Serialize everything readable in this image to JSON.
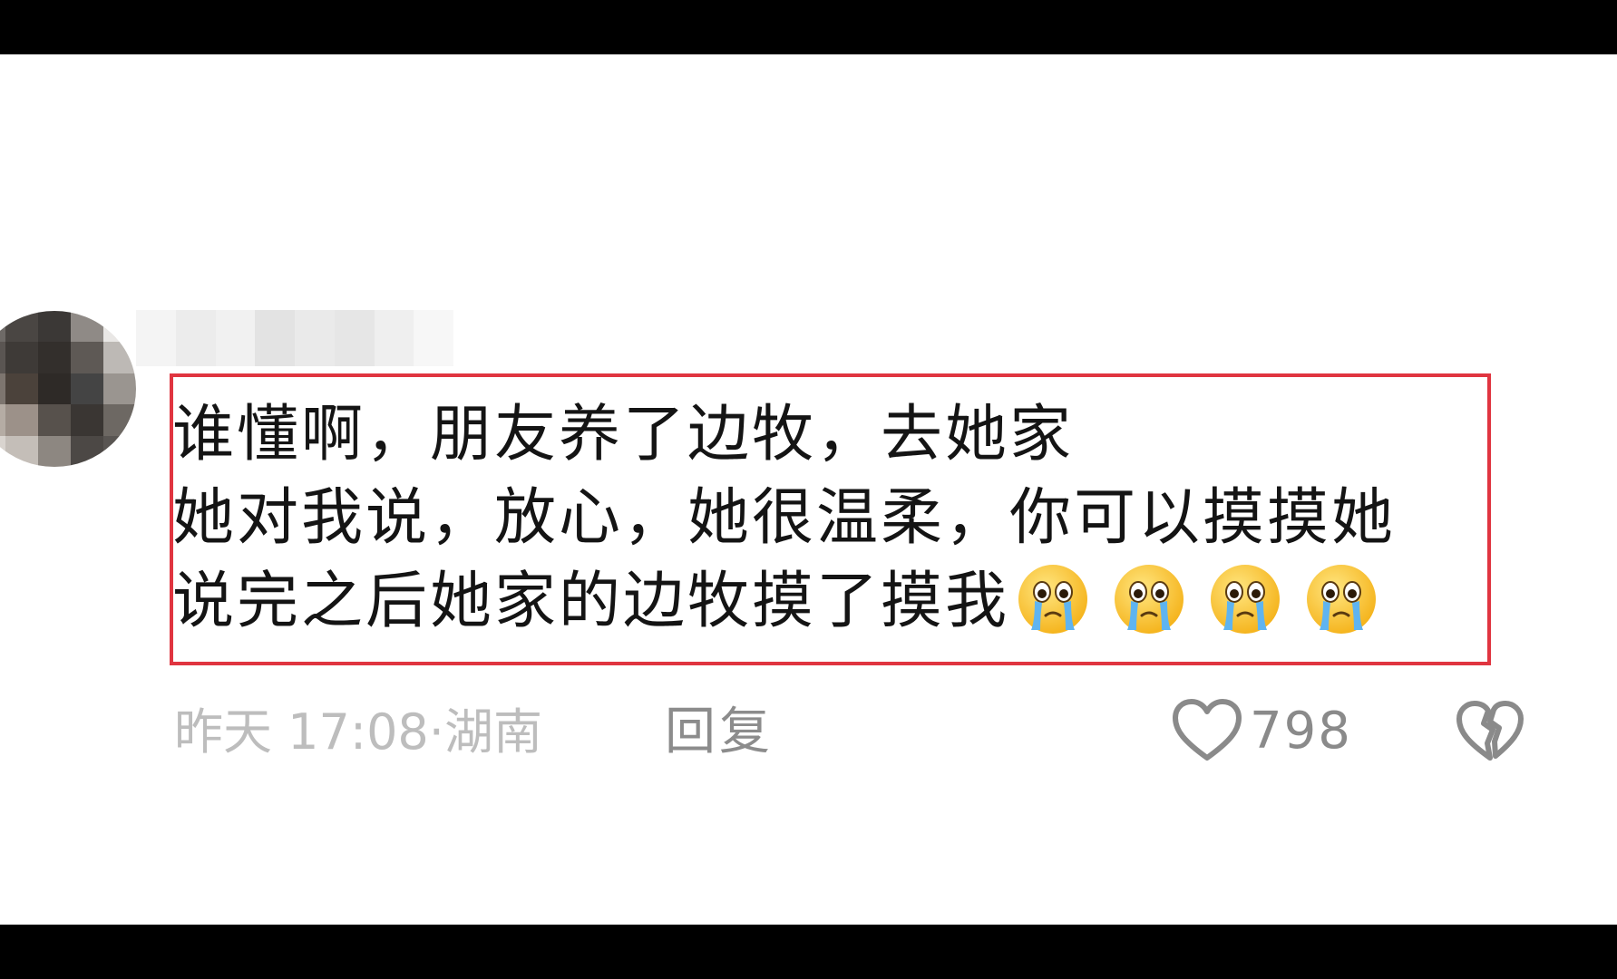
{
  "comment": {
    "lines": [
      "谁懂啊，朋友养了边牧，去她家",
      "她对我说，放心，她很温柔，你可以摸摸她",
      "说完之后她家的边牧摸了摸我"
    ],
    "emojis": [
      "crying-face-icon",
      "crying-face-icon",
      "crying-face-icon",
      "crying-face-icon"
    ],
    "highlight_color": "#e03540"
  },
  "meta": {
    "time": "昨天 17:08",
    "separator": "·",
    "location": "湖南",
    "reply_label": "回复",
    "like_count": "798"
  },
  "icons": {
    "like": "heart-outline-icon",
    "dislike": "broken-heart-icon"
  },
  "colors": {
    "text": "#141414",
    "meta_text": "#bdbdbd",
    "reply_text": "#8c8c8c",
    "letterbox": "#000000"
  }
}
